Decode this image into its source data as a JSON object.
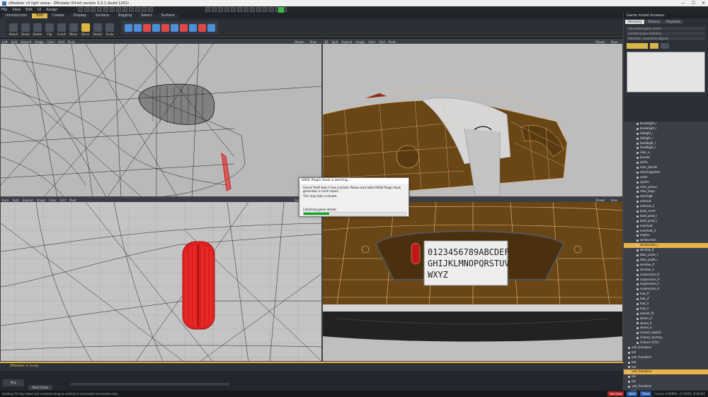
{
  "window": {
    "title": "zModeler v3 light setup - ZModeler 64-bit version 3.3.1 (build 1261)",
    "min": "—",
    "max": "☐",
    "close": "✕"
  },
  "menu": [
    "File",
    "View",
    "Edit",
    "UI",
    "Assign"
  ],
  "tabs": [
    {
      "label": "Introduction",
      "active": false
    },
    {
      "label": "Edit",
      "active": true
    },
    {
      "label": "Create",
      "active": false
    },
    {
      "label": "Display",
      "active": false
    },
    {
      "label": "Surface",
      "active": false
    },
    {
      "label": "Rigging",
      "active": false
    },
    {
      "label": "Select",
      "active": false
    },
    {
      "label": "Surface",
      "active": false
    }
  ],
  "ribbon": [
    "Attach",
    "Break",
    "Delete",
    "Flip",
    "Invert",
    "Mirror",
    "Mirror",
    "Rotate",
    "Scale"
  ],
  "viewports": {
    "topleft": {
      "name": "Left",
      "menus": [
        "Split",
        "Expand",
        "Image",
        "Color",
        "Grid",
        "Pivot"
      ],
      "right": [
        "Shown",
        "View"
      ]
    },
    "topright": {
      "name": "3D",
      "menus": [
        "Split",
        "Expand",
        "Image",
        "Color",
        "Grid",
        "Pivot"
      ],
      "right": [
        "Shown",
        "View"
      ]
    },
    "bottomleft": {
      "name": "Back",
      "menus": [
        "Split",
        "Expand",
        "Image",
        "Color",
        "Grid",
        "Pivot"
      ],
      "right": [
        "Shown",
        "View"
      ]
    },
    "bottomright": {
      "name": "3D",
      "menus": [
        "Split",
        "Expand",
        "Image",
        "Color",
        "Grid",
        "Pivot"
      ],
      "right": [
        "Shown",
        "View"
      ]
    }
  },
  "dialog": {
    "title": "RAGE Plugin Hook is working...",
    "message": "Grand Theft Auto V has crashed. Please wait while RAGE Plugin Hook generates a crash report.",
    "note": "This may take a minute.",
    "status": "Collecting game details",
    "progress": 0.25
  },
  "license_plate": {
    "line1": "0123456789ABCDEF",
    "line2": "GHIJKLMNOPQRSTUV",
    "line3": "WXYZ"
  },
  "rightpanel": {
    "title": "Game model browser",
    "tabs": [
      {
        "label": "Hierarchy",
        "active": true
      },
      {
        "label": "Textures",
        "active": false
      },
      {
        "label": "Properties",
        "active": false
      }
    ],
    "fields": [
      "Converted game scene",
      "Current scene statistics",
      "Selection, show/hide objects"
    ],
    "tree": [
      {
        "label": "brakelight_l",
        "selected": false
      },
      {
        "label": "brakelight_r",
        "selected": false
      },
      {
        "label": "taillight_l",
        "selected": false
      },
      {
        "label": "taillight_r",
        "selected": false
      },
      {
        "label": "headlight_l",
        "selected": false
      },
      {
        "label": "headlight_r",
        "selected": false
      },
      {
        "label": "misc_a",
        "selected": false
      },
      {
        "label": "bonnet",
        "selected": false
      },
      {
        "label": "skirts",
        "selected": false
      },
      {
        "label": "misc_decals",
        "selected": false
      },
      {
        "label": "steeringwheel",
        "selected": false
      },
      {
        "label": "seats",
        "selected": false
      },
      {
        "label": "spoiler",
        "selected": false
      },
      {
        "label": "misc_plexus",
        "selected": false
      },
      {
        "label": "misc_bags",
        "selected": false
      },
      {
        "label": "steelrigit",
        "selected": false
      },
      {
        "label": "exhaust",
        "selected": false
      },
      {
        "label": "exhaust_2",
        "selected": false
      },
      {
        "label": "boot_cover",
        "selected": false
      },
      {
        "label": "boot_pivot_l",
        "selected": false
      },
      {
        "label": "boot_pivot_r",
        "selected": false
      },
      {
        "label": "overheat",
        "selected": false
      },
      {
        "label": "overheat_2",
        "selected": false
      },
      {
        "label": "engine",
        "selected": false
      },
      {
        "label": "windscreen",
        "selected": false
      },
      {
        "label": "windscreen_r",
        "selected": true
      },
      {
        "label": "window_lf",
        "selected": false
      },
      {
        "label": "door_pside_f",
        "selected": false
      },
      {
        "label": "door_pside_r",
        "selected": false
      },
      {
        "label": "window_rf",
        "selected": false
      },
      {
        "label": "window_rr",
        "selected": false
      },
      {
        "label": "suspension_lf",
        "selected": false
      },
      {
        "label": "suspension_rf",
        "selected": false
      },
      {
        "label": "suspension_lr",
        "selected": false
      },
      {
        "label": "suspension_rr",
        "selected": false
      },
      {
        "label": "hub_lf",
        "selected": false
      },
      {
        "label": "hub_rf",
        "selected": false
      },
      {
        "label": "hub_lr",
        "selected": false
      },
      {
        "label": "hub_rr",
        "selected": false
      },
      {
        "label": "[wheel_lf]",
        "selected": false
      },
      {
        "label": "wheel_rf",
        "selected": false
      },
      {
        "label": "wheel_lr",
        "selected": false
      },
      {
        "label": "wheel_rr",
        "selected": false
      },
      {
        "label": "chassis_lowlod",
        "selected": false
      },
      {
        "label": "chassis_dummy",
        "selected": false
      },
      {
        "label": "chassis (COL)",
        "selected": false
      },
      {
        "label": "veh_fracdecal",
        "selected": false
      },
      {
        "label": "lod",
        "selected": false
      },
      {
        "label": "veh_fracdecal",
        "selected": false
      },
      {
        "label": "lod",
        "selected": false
      },
      {
        "label": "lod",
        "selected": false
      },
      {
        "label": "veh_fracdecal",
        "selected": true
      },
      {
        "label": "vlo",
        "selected": false
      },
      {
        "label": "vlo",
        "selected": false
      },
      {
        "label": "veh_fracdecal",
        "selected": false
      },
      {
        "label": "lod",
        "selected": false
      },
      {
        "label": "lod",
        "selected": false
      }
    ]
  },
  "status": {
    "message": "ZModeler is ready."
  },
  "bottom": {
    "play": "Play",
    "next": "Next frame"
  },
  "footer": {
    "hint": "Holding Ctrl key down will constrain drag to vertical or horizontal movement only.",
    "chips": [
      {
        "label": "Selected",
        "color": "#b02020"
      },
      {
        "label": "Rect",
        "color": "#2a5fb0"
      },
      {
        "label": "Pivot",
        "color": "#2a5fb0"
      }
    ],
    "cursor": "Cursor: 0.00963, -0.70402, 0.56341"
  },
  "colors": {
    "accent": "#e0b640",
    "car_body": "#6a4516",
    "wire_line": "#e8c07a",
    "light_red": "#e21f1f"
  }
}
